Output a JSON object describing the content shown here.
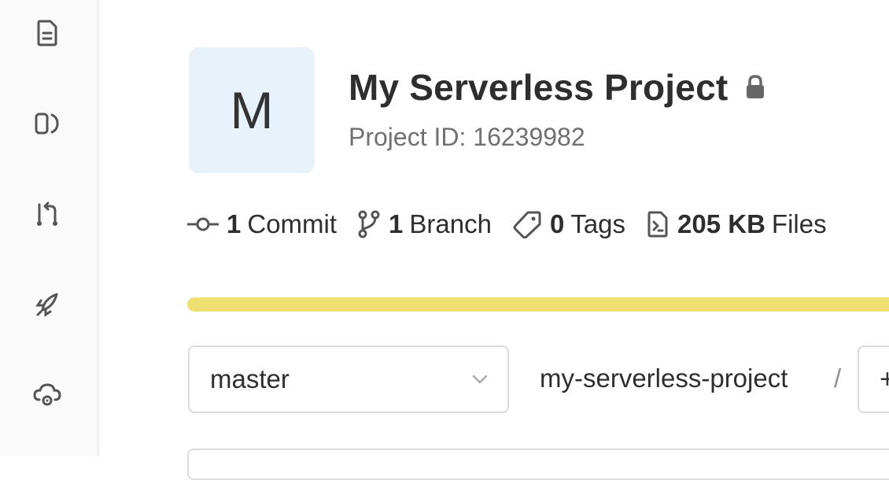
{
  "sidebar": {
    "items": [
      {
        "icon": "file-icon"
      },
      {
        "icon": "issues-icon"
      },
      {
        "icon": "merge-request-icon"
      },
      {
        "icon": "rocket-icon"
      },
      {
        "icon": "cloud-gear-icon"
      }
    ]
  },
  "project": {
    "avatar_letter": "M",
    "title": "My Serverless Project",
    "visibility_icon": "lock-icon",
    "id_label": "Project ID: 16239982"
  },
  "stats": {
    "commits": {
      "count": "1",
      "label": "Commit",
      "icon": "commit-icon"
    },
    "branches": {
      "count": "1",
      "label": "Branch",
      "icon": "branch-icon"
    },
    "tags": {
      "count": "0",
      "label": "Tags",
      "icon": "tag-icon"
    },
    "files": {
      "count": "205 KB",
      "label": "Files",
      "icon": "file-code-icon"
    }
  },
  "language_bar": {
    "fill_fraction": 1.0,
    "color": "#efdf70"
  },
  "repo": {
    "branch": "master",
    "path_root": "my-serverless-project",
    "separator": "/",
    "add_button_glyph": "+"
  }
}
